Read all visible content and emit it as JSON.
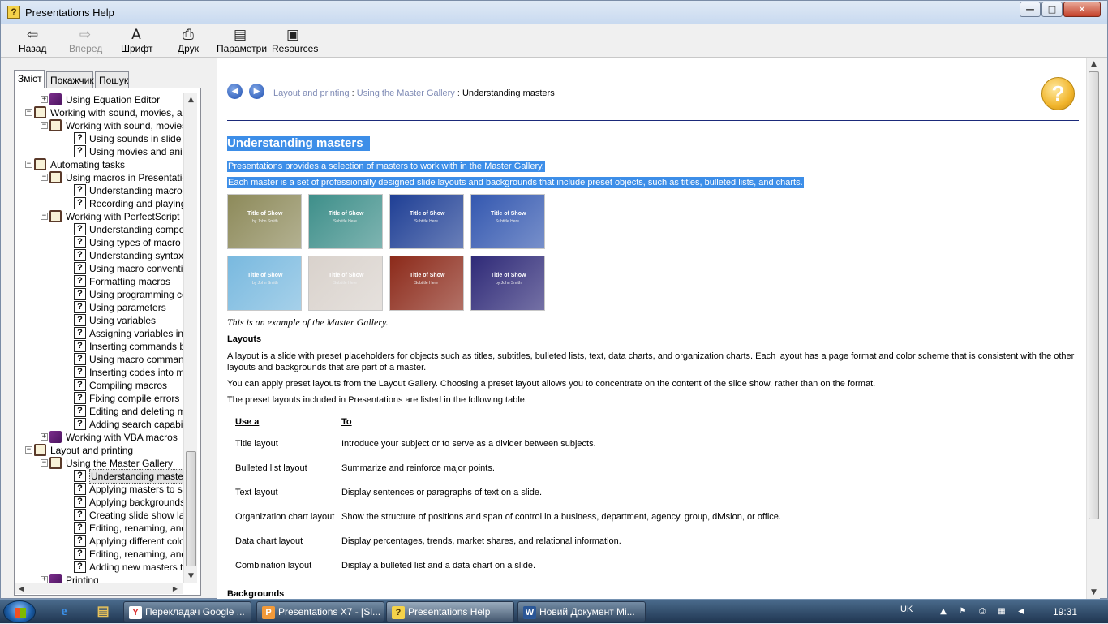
{
  "window": {
    "title": "Presentations Help"
  },
  "window_controls": {
    "minimize": "—",
    "maximize": "□",
    "close": "✕"
  },
  "toolbar": {
    "back": {
      "label": "Назад",
      "icon": "arrow-left-icon"
    },
    "forward": {
      "label": "Вперед",
      "icon": "arrow-right-icon"
    },
    "font": {
      "label": "Шрифт",
      "icon": "font-icon"
    },
    "print": {
      "label": "Друк",
      "icon": "printer-icon"
    },
    "options": {
      "label": "Параметри",
      "icon": "options-icon"
    },
    "resources": {
      "label": "Resources",
      "icon": "resources-icon"
    }
  },
  "nav_tabs": [
    "Зміст",
    "Покажчик",
    "Пошук"
  ],
  "tree": [
    {
      "level": 1,
      "type": "book",
      "expander": "+",
      "label": "Using Equation Editor"
    },
    {
      "level": 0,
      "type": "book-open",
      "expander": "−",
      "label": "Working with sound, movies, and"
    },
    {
      "level": 1,
      "type": "book-open",
      "expander": "−",
      "label": "Working with sound, movies, a"
    },
    {
      "level": 2,
      "type": "topic",
      "label": "Using sounds in slide show"
    },
    {
      "level": 2,
      "type": "topic",
      "label": "Using movies and animatio"
    },
    {
      "level": 0,
      "type": "book-open",
      "expander": "−",
      "label": "Automating tasks"
    },
    {
      "level": 1,
      "type": "book-open",
      "expander": "−",
      "label": "Using macros in Presentations"
    },
    {
      "level": 2,
      "type": "topic",
      "label": "Understanding macros"
    },
    {
      "level": 2,
      "type": "topic",
      "label": "Recording and playing ma"
    },
    {
      "level": 1,
      "type": "book-open",
      "expander": "−",
      "label": "Working with PerfectScript ma"
    },
    {
      "level": 2,
      "type": "topic",
      "label": "Understanding componen"
    },
    {
      "level": 2,
      "type": "topic",
      "label": "Using types of macro com"
    },
    {
      "level": 2,
      "type": "topic",
      "label": "Understanding syntax"
    },
    {
      "level": 2,
      "type": "topic",
      "label": "Using macro conventions"
    },
    {
      "level": 2,
      "type": "topic",
      "label": "Formatting macros"
    },
    {
      "level": 2,
      "type": "topic",
      "label": "Using programming comma"
    },
    {
      "level": 2,
      "type": "topic",
      "label": "Using parameters"
    },
    {
      "level": 2,
      "type": "topic",
      "label": "Using variables"
    },
    {
      "level": 2,
      "type": "topic",
      "label": "Assigning variables in Perf"
    },
    {
      "level": 2,
      "type": "topic",
      "label": "Inserting commands by us"
    },
    {
      "level": 2,
      "type": "topic",
      "label": "Using macro commands to"
    },
    {
      "level": 2,
      "type": "topic",
      "label": "Inserting codes into macro"
    },
    {
      "level": 2,
      "type": "topic",
      "label": "Compiling macros"
    },
    {
      "level": 2,
      "type": "topic",
      "label": "Fixing compile errors"
    },
    {
      "level": 2,
      "type": "topic",
      "label": "Editing and deleting macro"
    },
    {
      "level": 2,
      "type": "topic",
      "label": "Adding search capabilities"
    },
    {
      "level": 1,
      "type": "book",
      "expander": "+",
      "label": "Working with VBA macros"
    },
    {
      "level": 0,
      "type": "book-open",
      "expander": "−",
      "label": "Layout and printing"
    },
    {
      "level": 1,
      "type": "book-open",
      "expander": "−",
      "label": "Using the Master Gallery"
    },
    {
      "level": 2,
      "type": "topic",
      "label": "Understanding masters",
      "selected": true
    },
    {
      "level": 2,
      "type": "topic",
      "label": "Applying masters to slides"
    },
    {
      "level": 2,
      "type": "topic",
      "label": "Applying backgrounds and"
    },
    {
      "level": 2,
      "type": "topic",
      "label": "Creating slide show layout"
    },
    {
      "level": 2,
      "type": "topic",
      "label": "Editing, renaming, and del"
    },
    {
      "level": 2,
      "type": "topic",
      "label": "Applying different colors ar"
    },
    {
      "level": 2,
      "type": "topic",
      "label": "Editing, renaming, and del"
    },
    {
      "level": 2,
      "type": "topic",
      "label": "Adding new masters to the"
    },
    {
      "level": 1,
      "type": "book",
      "expander": "+",
      "label": "Printing"
    }
  ],
  "scroll_arrows": {
    "up": "▲",
    "down": "▼",
    "left": "◀",
    "right": "▶",
    "grip": "≡"
  },
  "topic": {
    "nav_back_icon": "circle-back-icon",
    "nav_forward_icon": "circle-forward-icon",
    "nav_back_glyph": "◀",
    "nav_forward_glyph": "▶",
    "breadcrumb": [
      "Layout and printing",
      "Using the Master Gallery",
      "Understanding masters"
    ],
    "breadcrumb_sep": " : ",
    "help_glyph": "?",
    "title": "Understanding masters",
    "intro_1": "Presentations provides a selection of masters to work with in the Master Gallery.",
    "intro_2": "Each master is a set of professionally designed slide layouts and backgrounds that include preset objects, such as titles, bulleted lists, and charts.",
    "caption": "This is an example of the Master Gallery.",
    "layouts_heading": "Layouts",
    "layouts_p1": "A layout is a slide with preset placeholders for objects such as titles, subtitles, bulleted lists, text, data charts, and organization charts. Each layout has a page format and color scheme that is consistent with the other layouts and backgrounds that are part of a master.",
    "layouts_p2": "You can apply preset layouts from the Layout Gallery. Choosing a preset layout allows you to concentrate on the content of the slide show, rather than on the format.",
    "layouts_p3": "The preset layouts included in Presentations are listed in the following table.",
    "table_header": {
      "use": "Use a",
      "to": "To"
    },
    "table_rows": [
      {
        "use": "Title layout",
        "to": "Introduce your subject or to serve as a divider between subjects."
      },
      {
        "use": "Bulleted list layout",
        "to": "Summarize and reinforce major points."
      },
      {
        "use": "Text layout",
        "to": "Display sentences or paragraphs of text on a slide."
      },
      {
        "use": "Organization chart layout",
        "to": "Show the structure of positions and span of control in a business, department, agency, group, division, or office."
      },
      {
        "use": "Data chart layout",
        "to": "Display percentages, trends, market shares, and relational information."
      },
      {
        "use": "Combination layout",
        "to": "Display a bulleted list and a data chart on a slide."
      }
    ],
    "backgrounds_heading": "Backgrounds",
    "master_thumbnails": [
      {
        "title": "Title of Show",
        "subtitle": "by John Smith",
        "bg": "#8d8a5a"
      },
      {
        "title": "Title of Show",
        "subtitle": "Subtitle Here",
        "bg": "#3e8f8a"
      },
      {
        "title": "Title of Show",
        "subtitle": "Subtitle Here",
        "bg": "#1f3f95"
      },
      {
        "title": "Title of Show",
        "subtitle": "Subtitle Here",
        "bg": "#3458b0"
      },
      {
        "title": "Title of Show",
        "subtitle": "by John Smith",
        "bg": "#79b9df"
      },
      {
        "title": "Title of Show",
        "subtitle": "Subtitle Here",
        "bg": "#d9d2cc"
      },
      {
        "title": "Title of Show",
        "subtitle": "Subtitle Here",
        "bg": "#8c2a1a"
      },
      {
        "title": "Title of Show",
        "subtitle": "by John Smith",
        "bg": "#2f2a78"
      }
    ]
  },
  "taskbar": {
    "start_icon": "windows-start-icon",
    "pinned": [
      {
        "icon": "internet-explorer-icon",
        "glyph": "e",
        "color": "#3a8ee6"
      },
      {
        "icon": "folder-icon",
        "glyph": "▤",
        "color": "#e8c25a"
      }
    ],
    "tasks": [
      {
        "label": "Перекладач Google ...",
        "icon": "yandex-browser-icon",
        "glyph": "Y",
        "icon_bg": "#ffffff",
        "icon_fg": "#d92a2a"
      },
      {
        "label": "Presentations X7 - [Sl...",
        "icon": "presentations-icon",
        "glyph": "P",
        "icon_bg": "#f29a3a",
        "icon_fg": "#ffffff"
      },
      {
        "label": "Presentations Help",
        "icon": "help-icon",
        "glyph": "?",
        "icon_bg": "#f4d24a",
        "icon_fg": "#4a3200",
        "active": true
      },
      {
        "label": "Новий Документ Mi...",
        "icon": "word-icon",
        "glyph": "W",
        "icon_bg": "#2b5797",
        "icon_fg": "#ffffff"
      }
    ],
    "tray": {
      "language": "UK",
      "icons": [
        {
          "name": "show-hidden-icons-icon",
          "glyph": "▲"
        },
        {
          "name": "flag-icon",
          "glyph": "⚑"
        },
        {
          "name": "printer-tray-icon",
          "glyph": "⎙"
        },
        {
          "name": "network-icon",
          "glyph": "▦"
        },
        {
          "name": "volume-icon",
          "glyph": "◀"
        }
      ],
      "time": "19:31"
    }
  }
}
